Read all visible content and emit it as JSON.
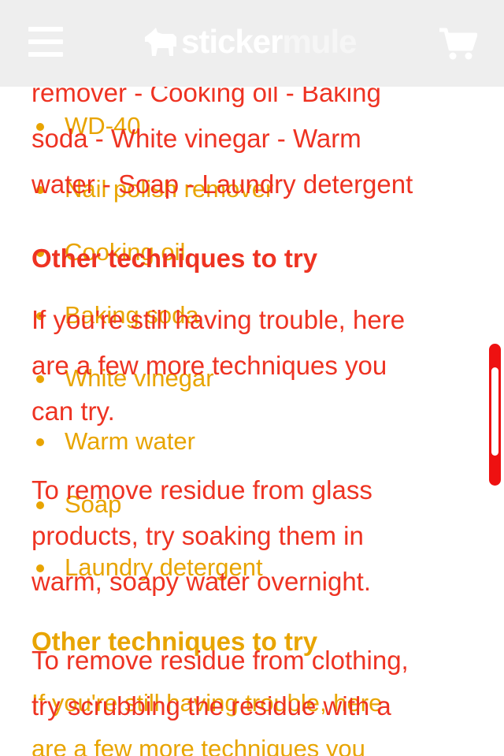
{
  "header": {
    "menu_icon": "hamburger-menu-icon",
    "logo_part1": "sticker",
    "logo_part2": "mule",
    "logo_icon": "mule-logo-icon",
    "cart_icon": "shopping-cart-icon"
  },
  "article": {
    "paragraph1_lines": [
      "remover - Cooking oil - Baking",
      "soda - White vinegar - Warm",
      "water - Soap - Laundry detergent"
    ],
    "heading1": "Other techniques to try",
    "paragraph2_lines": [
      "If you're still having trouble, here",
      "are a few more techniques you",
      "can try."
    ],
    "paragraph3_lines": [
      "To remove residue from glass",
      "products, try soaking them in",
      "warm, soapy water overnight."
    ],
    "paragraph4_lines": [
      "To remove residue from clothing,",
      "try scrubbing the residue with a"
    ]
  },
  "overlay": {
    "list_items": [
      "WD-40",
      "Nail polish remover",
      "Cooking oil",
      "Baking soda",
      "White vinegar",
      "Warm water",
      "Soap",
      "Laundry detergent"
    ],
    "heading": "Other techniques to try",
    "intro_lines": [
      "If you're still having trouble, here",
      "are a few more techniques you"
    ]
  },
  "colors": {
    "text_red": "#ee3322",
    "text_yellow": "#e8a400",
    "header_bg": "#eeeeee",
    "scrollbar": "#ee1111"
  },
  "scrollbar": {
    "position": 0.42
  }
}
